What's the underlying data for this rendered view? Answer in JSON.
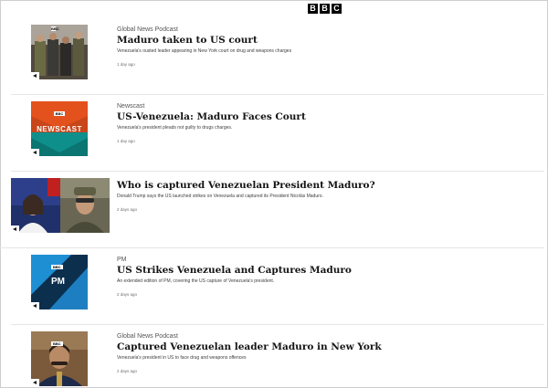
{
  "header": {
    "logo_letters": [
      "B",
      "B",
      "C"
    ]
  },
  "items": [
    {
      "kicker": "Global News Podcast",
      "title": "Maduro taken to US court",
      "description": "Venezuela's ousted leader appearing in New York court on drug and weapons charges",
      "time": "1 day ago",
      "thumb_label": "BBC",
      "thumb_icon": "audio-icon"
    },
    {
      "kicker": "Newscast",
      "title": "US-Venezuela: Maduro Faces Court",
      "description": "Venezuela's president pleads not guilty to drugs charges.",
      "time": "1 day ago",
      "thumb_label": "BBC",
      "thumb_brand": "NEWSCAST",
      "thumb_icon": "audio-icon"
    },
    {
      "kicker": "",
      "title": "Who is captured Venezuelan President Maduro?",
      "description": "Donald Trump says the US launched strikes on Venezuela and captured its President Nicolás Maduro.",
      "time": "2 days ago",
      "thumb_icon": "video-icon"
    },
    {
      "kicker": "PM",
      "title": "US Strikes Venezuela and Captures Maduro",
      "description": "An extended edition of PM, covering the US capture of Venezuela's president.",
      "time": "2 days ago",
      "thumb_label": "BBC",
      "thumb_brand": "PM",
      "thumb_icon": "audio-icon"
    },
    {
      "kicker": "Global News Podcast",
      "title": "Captured Venezuelan leader Maduro in New York",
      "description": "Venezuela's president in US to face drug and weapons offences",
      "time": "2 days ago",
      "thumb_label": "BBC",
      "thumb_icon": "audio-icon"
    }
  ],
  "colors": {
    "newscast_orange": "#e3521c",
    "newscast_teal": "#0f8f8c",
    "pm_blue": "#1d7fc1",
    "pm_dark": "#0d2f4e"
  }
}
